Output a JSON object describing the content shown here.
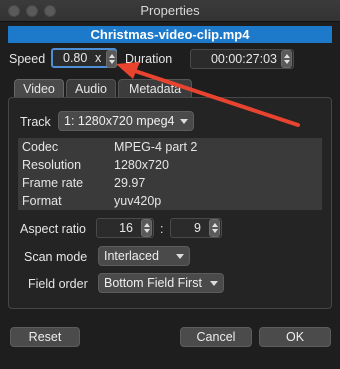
{
  "window": {
    "title": "Properties"
  },
  "file": {
    "name": "Christmas-video-clip.mp4"
  },
  "speed": {
    "label": "Speed",
    "value": "0.80",
    "unit": "x"
  },
  "duration": {
    "label": "Duration",
    "value": "00:00:27:03"
  },
  "tabs": [
    {
      "label": "Video",
      "active": true
    },
    {
      "label": "Audio",
      "active": false
    },
    {
      "label": "Metadata",
      "active": false
    }
  ],
  "track": {
    "label": "Track",
    "selected": "1: 1280x720 mpeg4"
  },
  "info": [
    {
      "key": "Codec",
      "value": "MPEG-4 part 2"
    },
    {
      "key": "Resolution",
      "value": "1280x720"
    },
    {
      "key": "Frame rate",
      "value": "29.97"
    },
    {
      "key": "Format",
      "value": "yuv420p"
    }
  ],
  "aspect": {
    "label": "Aspect ratio",
    "num": "16",
    "sep": ":",
    "den": "9"
  },
  "scan_mode": {
    "label": "Scan mode",
    "selected": "Interlaced"
  },
  "field_order": {
    "label": "Field order",
    "selected": "Bottom Field First"
  },
  "buttons": {
    "reset": "Reset",
    "cancel": "Cancel",
    "ok": "OK"
  },
  "colors": {
    "accent": "#1d79c9",
    "annotation_arrow": "#e8432f",
    "background": "#1e1e1e"
  }
}
